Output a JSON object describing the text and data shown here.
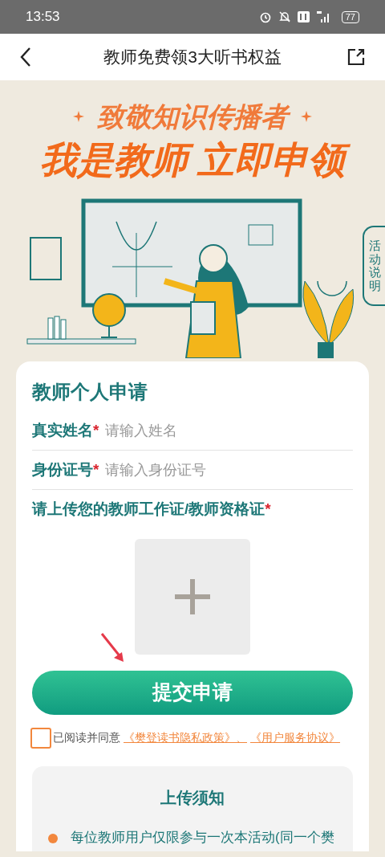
{
  "status_bar": {
    "time": "13:53",
    "battery": "77"
  },
  "nav": {
    "title": "教师免费领3大听书权益"
  },
  "banner": {
    "subtitle": "致敬知识传播者",
    "headline": "我是教师 立即申领",
    "side_tab": "活动说明"
  },
  "form": {
    "title": "教师个人申请",
    "fields": [
      {
        "label": "真实姓名",
        "required_mark": "*",
        "placeholder": "请输入姓名"
      },
      {
        "label": "身份证号",
        "required_mark": "*",
        "placeholder": "请输入身份证号"
      }
    ],
    "upload": {
      "label": "请上传您的教师工作证/教师资格证",
      "required_mark": "*"
    },
    "submit": "提交申请",
    "agreement": {
      "checked": false,
      "text": "已阅读并同意",
      "links": [
        "《樊登读书隐私政策》、",
        "《用户服务协议》"
      ]
    },
    "notice": {
      "title": "上传须知",
      "items": [
        "每位教师用户仅限参与一次本活动(同一个樊"
      ]
    }
  }
}
